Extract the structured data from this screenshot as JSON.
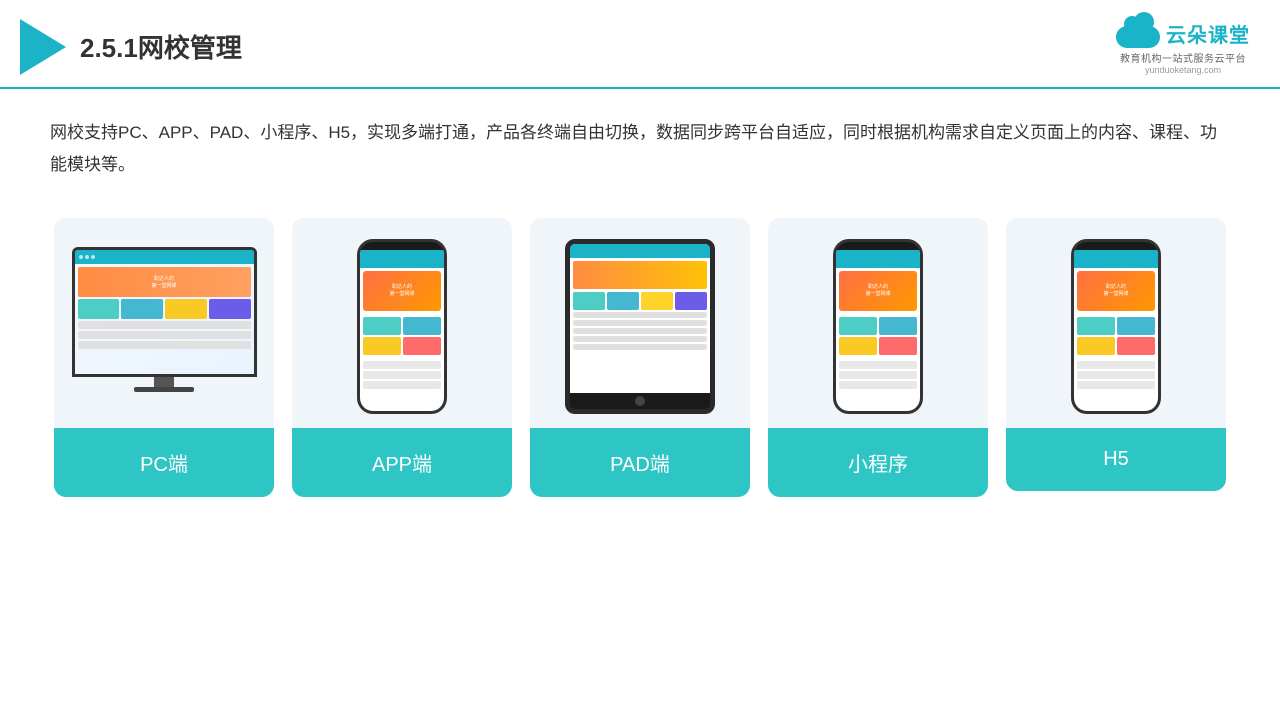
{
  "header": {
    "title": "2.5.1网校管理",
    "logo": {
      "name": "云朵课堂",
      "domain": "yunduoketang.com",
      "subtitle": "教育机构一站式服务云平台"
    }
  },
  "description": "网校支持PC、APP、PAD、小程序、H5，实现多端打通，产品各终端自由切换，数据同步跨平台自适应，同时根据机构需求自定义页面上的内容、课程、功能模块等。",
  "cards": [
    {
      "label": "PC端",
      "type": "pc"
    },
    {
      "label": "APP端",
      "type": "phone"
    },
    {
      "label": "PAD端",
      "type": "tablet"
    },
    {
      "label": "小程序",
      "type": "phone"
    },
    {
      "label": "H5",
      "type": "phone"
    }
  ]
}
